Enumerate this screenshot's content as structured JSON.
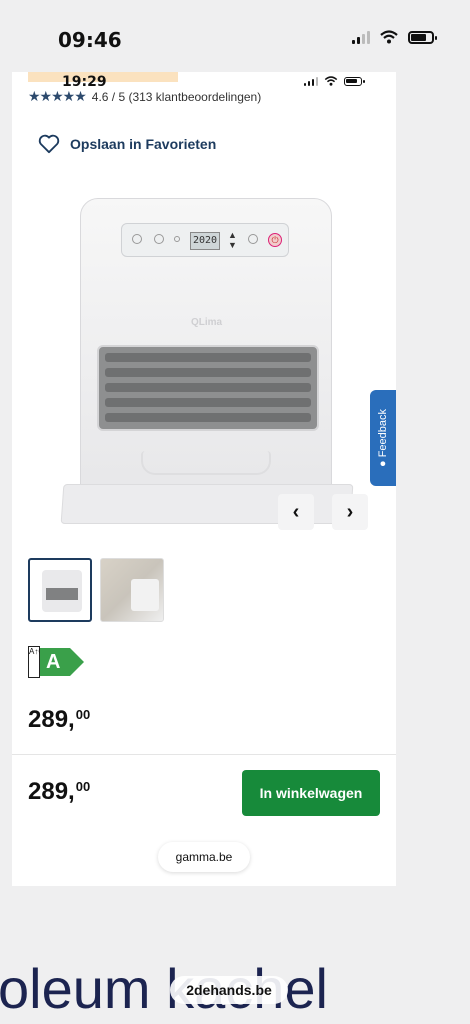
{
  "status_bar": {
    "time": "09:46"
  },
  "inner_status": {
    "time": "19:29"
  },
  "rating": {
    "stars": "★★★★★",
    "text": "4.6 / 5 (313 klantbeoordelingen)",
    "value": 4.6
  },
  "favorites": {
    "label": "Opslaan in Favorieten"
  },
  "product": {
    "lcd": "2020",
    "brand": "QLima"
  },
  "feedback": {
    "label": "Feedback"
  },
  "energy": {
    "scale": "A↑G",
    "class": "A",
    "color": "#3aa04a"
  },
  "price": {
    "main": "289,",
    "cents": "00"
  },
  "footer": {
    "price_main": "289,",
    "price_cents": "00",
    "cart_label": "In winkelwagen",
    "cart_color": "#178a3a",
    "domain": "gamma.be"
  },
  "caption": {
    "text": "oleum kachel",
    "url": "2dehands.be"
  },
  "icons": {
    "heart": "heart-icon",
    "prev": "chevron-left-icon",
    "next": "chevron-right-icon",
    "chat": "chat-bubble-icon"
  }
}
